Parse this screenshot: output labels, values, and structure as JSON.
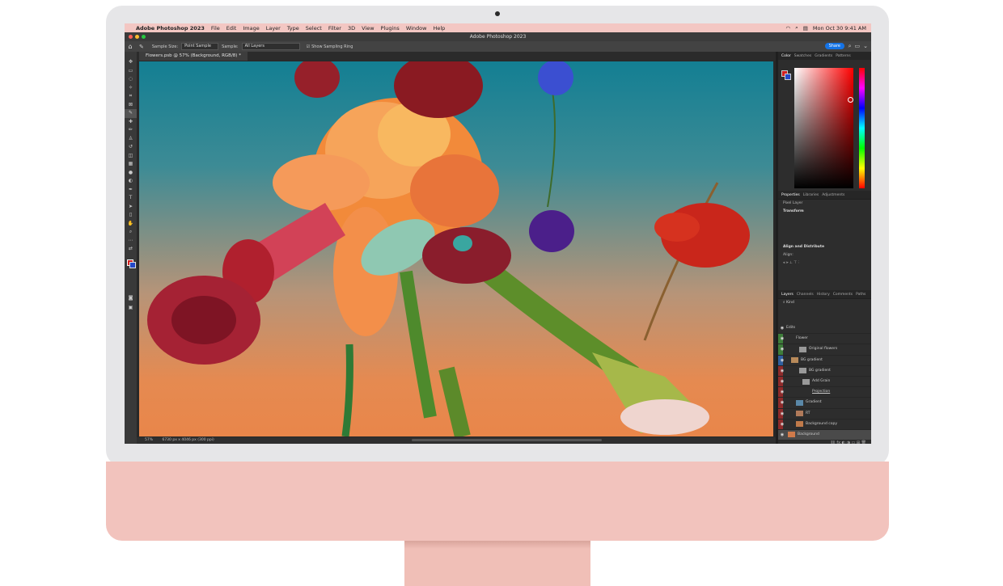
{
  "menubar": {
    "apple": "",
    "app_name": "Adobe Photoshop 2023",
    "items": [
      "File",
      "Edit",
      "Image",
      "Layer",
      "Type",
      "Select",
      "Filter",
      "3D",
      "View",
      "Plugins",
      "Window",
      "Help"
    ],
    "clock": "Mon Oct 30  9:41 AM"
  },
  "window": {
    "title": "Adobe Photoshop 2023",
    "document_tab": "Flowers.psb @ 57% (Background, RGB/8) *"
  },
  "options": {
    "sample_size_label": "Sample Size:",
    "sample_size_value": "Point Sample",
    "sample_label": "Sample:",
    "sample_value": "All Layers",
    "show_ring_label": "Show Sampling Ring",
    "share_label": "Share"
  },
  "status": {
    "zoom": "57%",
    "dimensions": "6730 px x 4046 px (300 ppi)"
  },
  "color_panel": {
    "tabs": [
      "Color",
      "Swatches",
      "Gradients",
      "Patterns"
    ],
    "foreground": "#d21f1f",
    "background": "#2448c8"
  },
  "properties_panel": {
    "tabs": [
      "Properties",
      "Libraries",
      "Adjustments"
    ],
    "layer_type": "Pixel Layer",
    "transform": "Transform",
    "align": "Align and Distribute",
    "align_sub": "Align:"
  },
  "layers_panel": {
    "tabs": [
      "Layers",
      "Channels",
      "History",
      "Comments",
      "Paths"
    ],
    "kind_filter": "Kind",
    "layers": [
      {
        "name": "Edits",
        "tag": ""
      },
      {
        "name": "Flower",
        "tag": "green"
      },
      {
        "name": "Original flowers",
        "tag": "green"
      },
      {
        "name": "BG gradient",
        "tag": "blue"
      },
      {
        "name": "BG gradient",
        "tag": "red"
      },
      {
        "name": "Add Grain",
        "tag": "red"
      },
      {
        "name": "Projection",
        "tag": "red"
      },
      {
        "name": "Gradient",
        "tag": "red"
      },
      {
        "name": "RT",
        "tag": "red"
      },
      {
        "name": "Background copy",
        "tag": "red"
      },
      {
        "name": "Background",
        "tag": ""
      }
    ]
  },
  "colors": {
    "chassis": "#f2c3bd",
    "menubar": "#f3c7c3",
    "ps_dark": "#2d2d2d",
    "share": "#1473e6"
  }
}
